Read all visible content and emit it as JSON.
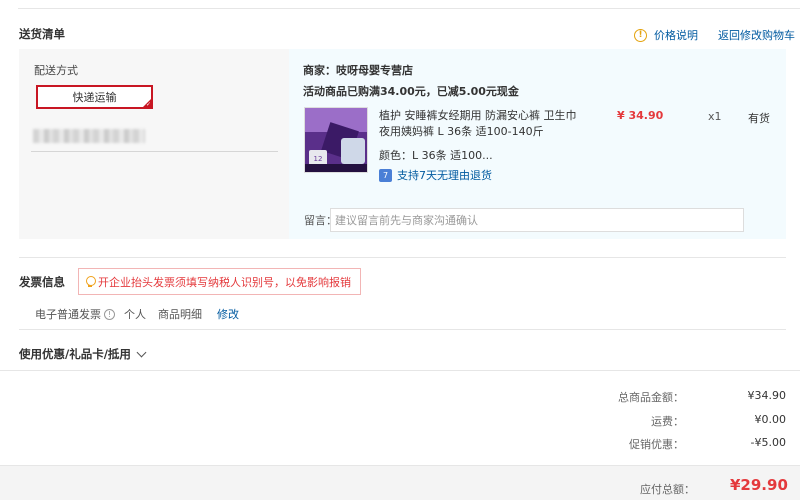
{
  "section": {
    "title": "送货清单",
    "price_note": "价格说明",
    "back_link": "返回修改购物车"
  },
  "shipping": {
    "label": "配送方式",
    "option": "快递运输"
  },
  "store": {
    "merchant": "商家：吱呀母婴专营店",
    "promo": "活动商品已购满34.00元，已减5.00元现金",
    "product": {
      "name": "植护 安睡裤女经期用 防漏安心裤 卫生巾夜用姨妈裤 L 36条 适100-140斤",
      "price": "¥ 34.90",
      "qty": "x1",
      "stock": "有货",
      "color": "颜色：L 36条 适100...",
      "return_policy": "支持7天无理由退货",
      "thumb_badge": "12"
    },
    "message_label": "留言：",
    "message_placeholder": "建议留言前先与商家沟通确认"
  },
  "invoice": {
    "title": "发票信息",
    "tip": "开企业抬头发票须填写纳税人识别号，以免影响报销",
    "type": "电子普通发票",
    "person": "个人",
    "detail": "商品明细",
    "edit": "修改"
  },
  "coupon": {
    "label": "使用优惠/礼品卡/抵用"
  },
  "summary": {
    "items_label": "总商品金额：",
    "items_value": "¥34.90",
    "freight_label": "运费：",
    "freight_value": "¥0.00",
    "discount_label": "促销优惠：",
    "discount_value": "-¥5.00",
    "total_label": "应付总额：",
    "total_value": "¥29.90"
  },
  "colors": {
    "accent_red": "#e4393c",
    "link_blue": "#005aa0",
    "warn_yellow": "#e4a30f"
  }
}
